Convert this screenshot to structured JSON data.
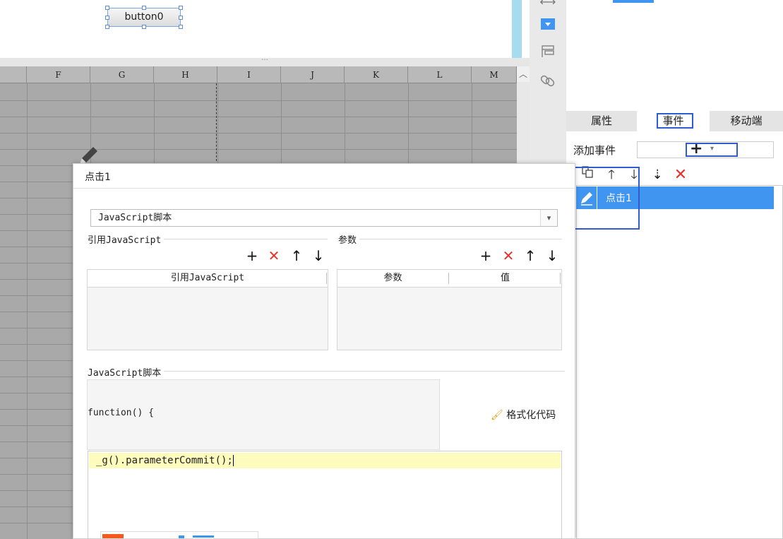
{
  "designer": {
    "button_label": "button0",
    "splitter_dots": "···"
  },
  "sheet": {
    "columns": [
      "F",
      "G",
      "H",
      "I",
      "J",
      "K",
      "L",
      "M"
    ],
    "scroll_up_icon": "chevron-up-icon"
  },
  "right_panel": {
    "tabs": [
      "属性",
      "事件",
      "移动端"
    ],
    "selected_tab": "事件",
    "add_event_label": "添加事件",
    "add_event_button": "+",
    "add_event_dropdown": "▾",
    "toolbar_icons": [
      "copy-icon",
      "arrow-up-icon",
      "arrow-down-icon",
      "sort-down-icon",
      "delete-icon"
    ],
    "events": [
      {
        "label": "点击1",
        "selected": true
      }
    ]
  },
  "dialog": {
    "title": "点击1",
    "type_value": "JavaScript脚本",
    "ref_js_group_label": "引用JavaScript",
    "ref_js_column": "引用JavaScript",
    "params_group_label": "参数",
    "params_columns": [
      "参数",
      "值"
    ],
    "script_group_label": "JavaScript脚本",
    "function_prefix": "function() {",
    "format_code_label": "格式化代码",
    "code_line": "_g().parameterCommit();"
  },
  "colors": {
    "accent_blue": "#3f95f0",
    "highlight_box": "#2f5bd3",
    "delete_red": "#e5332a",
    "code_highlight": "#fefcbc"
  }
}
